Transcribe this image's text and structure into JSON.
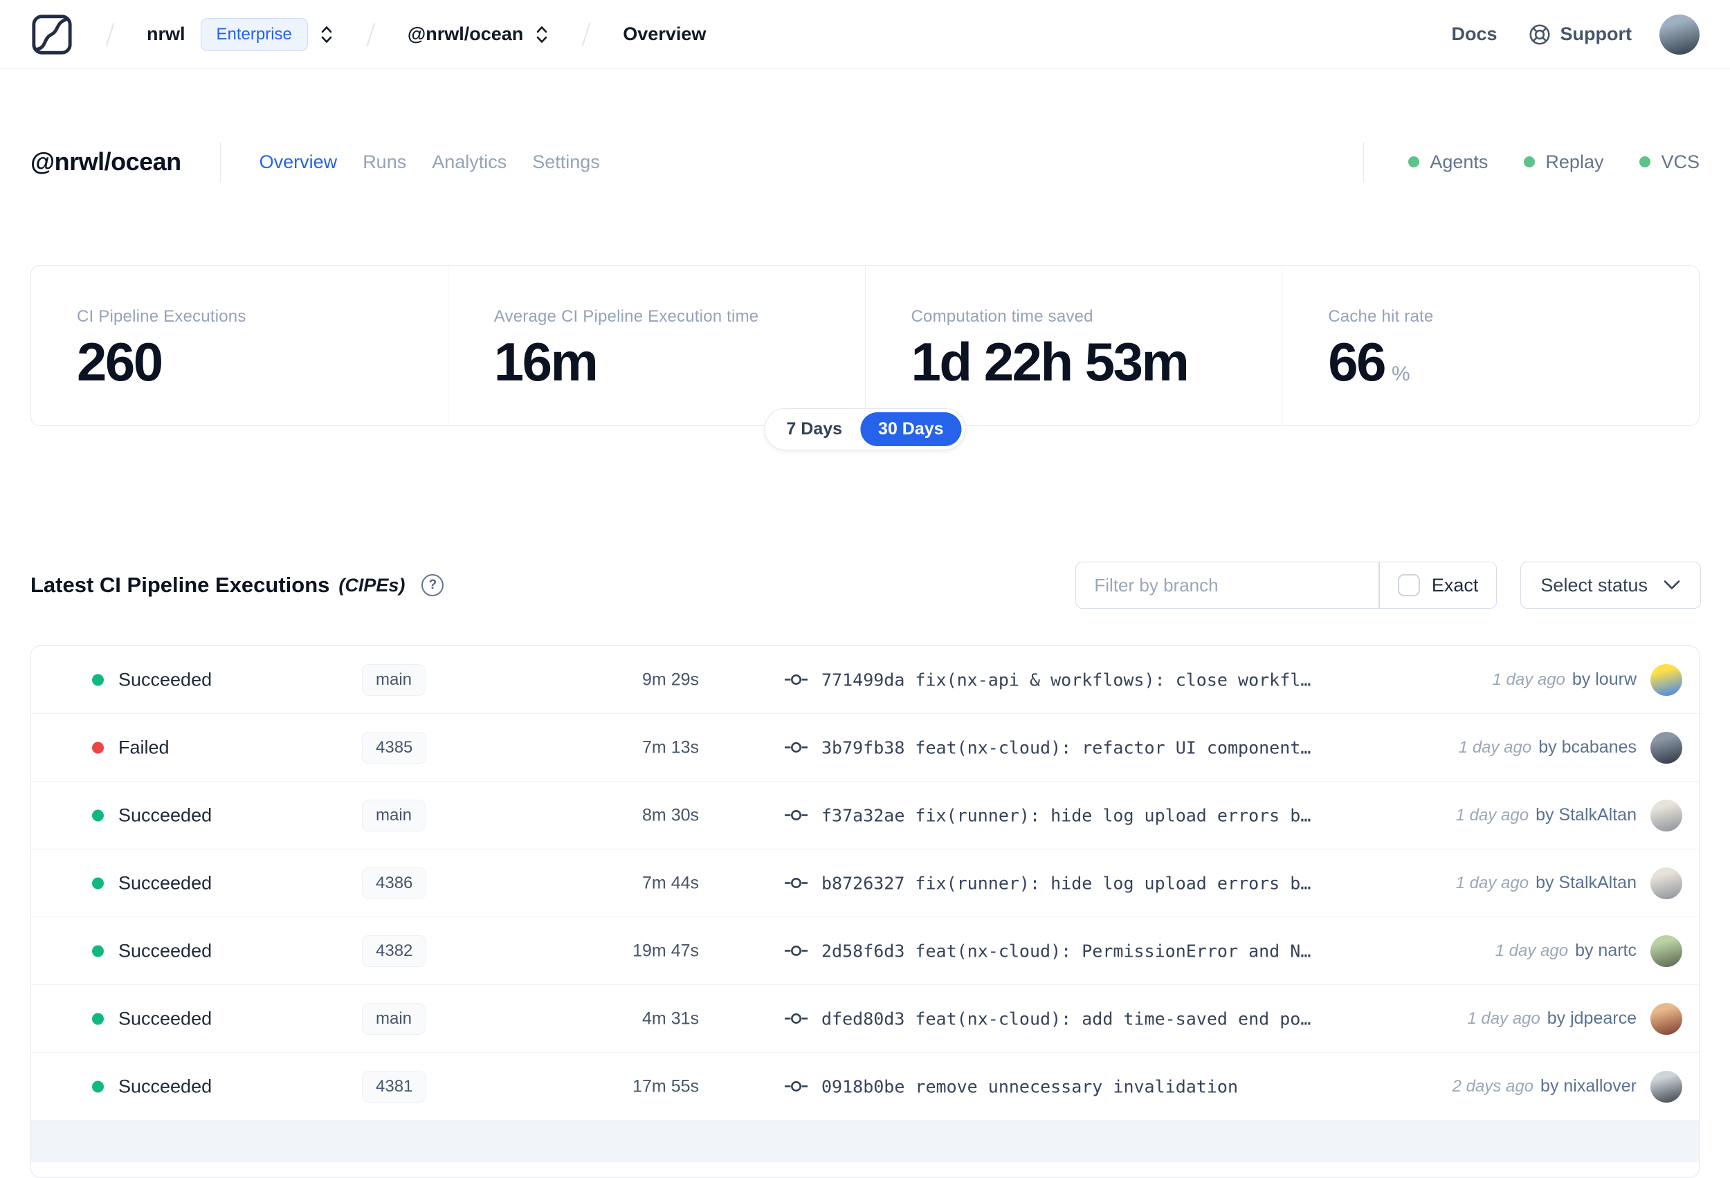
{
  "navbar": {
    "breadcrumb": {
      "org": "nrwl",
      "org_badge": "Enterprise",
      "workspace": "@nrwl/ocean",
      "page": "Overview"
    },
    "docs_label": "Docs",
    "support_label": "Support"
  },
  "header": {
    "title": "@nrwl/ocean",
    "tabs": [
      {
        "label": "Overview",
        "active": true
      },
      {
        "label": "Runs",
        "active": false
      },
      {
        "label": "Analytics",
        "active": false
      },
      {
        "label": "Settings",
        "active": false
      }
    ],
    "indicators": [
      {
        "label": "Agents"
      },
      {
        "label": "Replay"
      },
      {
        "label": "VCS"
      }
    ]
  },
  "stats": {
    "cards": [
      {
        "label": "CI Pipeline Executions",
        "value": "260",
        "suffix": ""
      },
      {
        "label": "Average CI Pipeline Execution time",
        "value": "16m",
        "suffix": ""
      },
      {
        "label": "Computation time saved",
        "value": "1d 22h 53m",
        "suffix": ""
      },
      {
        "label": "Cache hit rate",
        "value": "66",
        "suffix": "%"
      }
    ],
    "range_toggle": {
      "options": [
        "7 Days",
        "30 Days"
      ],
      "selected": "30 Days"
    }
  },
  "cipe": {
    "title": "Latest CI Pipeline Executions",
    "title_suffix": "(CIPEs)",
    "help_icon": "?",
    "filter": {
      "placeholder": "Filter by branch",
      "exact_label": "Exact",
      "exact_checked": false
    },
    "status_select_label": "Select status"
  },
  "table": {
    "rows": [
      {
        "status": "Succeeded",
        "status_type": "success",
        "branch": "main",
        "duration": "9m 29s",
        "commit_sha": "771499da",
        "commit_msg": "fix(nx-api & workflows): close workfl…",
        "time": "1 day ago",
        "author": "by lourw",
        "avatar_colors": [
          "#fde047",
          "#3b82f6"
        ]
      },
      {
        "status": "Failed",
        "status_type": "failed",
        "branch": "4385",
        "duration": "7m 13s",
        "commit_sha": "3b79fb38",
        "commit_msg": "feat(nx-cloud): refactor UI component…",
        "time": "1 day ago",
        "author": "by bcabanes",
        "avatar_colors": [
          "#8b97a5",
          "#2c3440"
        ]
      },
      {
        "status": "Succeeded",
        "status_type": "success",
        "branch": "main",
        "duration": "8m 30s",
        "commit_sha": "f37a32ae",
        "commit_msg": "fix(runner): hide log upload errors b…",
        "time": "1 day ago",
        "author": "by StalkAltan",
        "avatar_colors": [
          "#e8e3da",
          "#8a8f98"
        ]
      },
      {
        "status": "Succeeded",
        "status_type": "success",
        "branch": "4386",
        "duration": "7m 44s",
        "commit_sha": "b8726327",
        "commit_msg": "fix(runner): hide log upload errors b…",
        "time": "1 day ago",
        "author": "by StalkAltan",
        "avatar_colors": [
          "#e8e3da",
          "#8a8f98"
        ]
      },
      {
        "status": "Succeeded",
        "status_type": "success",
        "branch": "4382",
        "duration": "19m 47s",
        "commit_sha": "2d58f6d3",
        "commit_msg": "feat(nx-cloud): PermissionError and N…",
        "time": "1 day ago",
        "author": "by nartc",
        "avatar_colors": [
          "#b9d3a4",
          "#57634f"
        ]
      },
      {
        "status": "Succeeded",
        "status_type": "success",
        "branch": "main",
        "duration": "4m 31s",
        "commit_sha": "dfed80d3",
        "commit_msg": "feat(nx-cloud): add time-saved end po…",
        "time": "1 day ago",
        "author": "by jdpearce",
        "avatar_colors": [
          "#e9b98a",
          "#7a3b2e"
        ]
      },
      {
        "status": "Succeeded",
        "status_type": "success",
        "branch": "4381",
        "duration": "17m 55s",
        "commit_sha": "0918b0be",
        "commit_msg": "remove unnecessary invalidation",
        "time": "2 days ago",
        "author": "by nixallover",
        "avatar_colors": [
          "#cfd4da",
          "#3a4149"
        ]
      }
    ]
  },
  "user": {
    "avatar_colors": [
      "#9fb0c0",
      "#2f3a46"
    ]
  },
  "colors": {
    "accent_blue": "#2563eb",
    "success_green": "#10b981",
    "failed_red": "#ef4444",
    "indicator_green": "#5cc389"
  }
}
